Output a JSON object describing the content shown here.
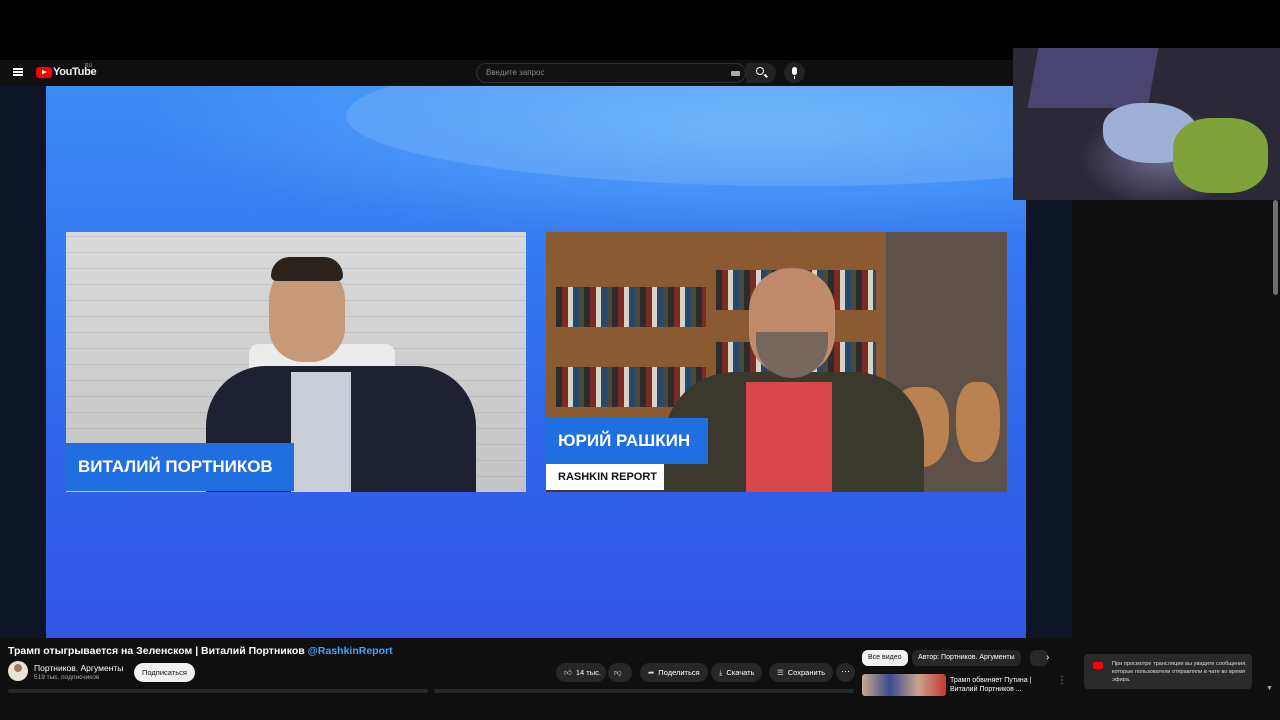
{
  "header": {
    "logo_text": "YouTube",
    "region": "RU",
    "search_placeholder": "Введите запрос"
  },
  "video": {
    "guest_left_name": "ВИТАЛИЙ ПОРТНИКОВ",
    "guest_right_name": "ЮРИЙ РАШКИН",
    "guest_right_show": "RASHKIN REPORT"
  },
  "meta": {
    "title_main": "Трамп отыгрывается на Зеленском | Виталий Портников ",
    "title_handle": "@RashkinReport",
    "channel_name": "Портников. Аргументы",
    "subscribers": "519 тыс. подписчиков",
    "subscribe_label": "Подписаться"
  },
  "actions": {
    "likes": "14 тыс.",
    "share": "Поделиться",
    "download": "Скачать",
    "save": "Сохранить"
  },
  "chips": {
    "all": "Все видео",
    "author": "Автор: Портников. Аргументы"
  },
  "recommended": {
    "title": "Трамп обвиняет Путина | Виталий Портников ..."
  },
  "chat_notice": {
    "text": "При просмотре трансляции вы увидите сообщения, которые пользователи отправляли в чате во время эфира."
  },
  "colors": {
    "accent_red": "#ff0000",
    "link_blue": "#3ea6ff",
    "lower_third_blue": "#1f6fe0"
  }
}
